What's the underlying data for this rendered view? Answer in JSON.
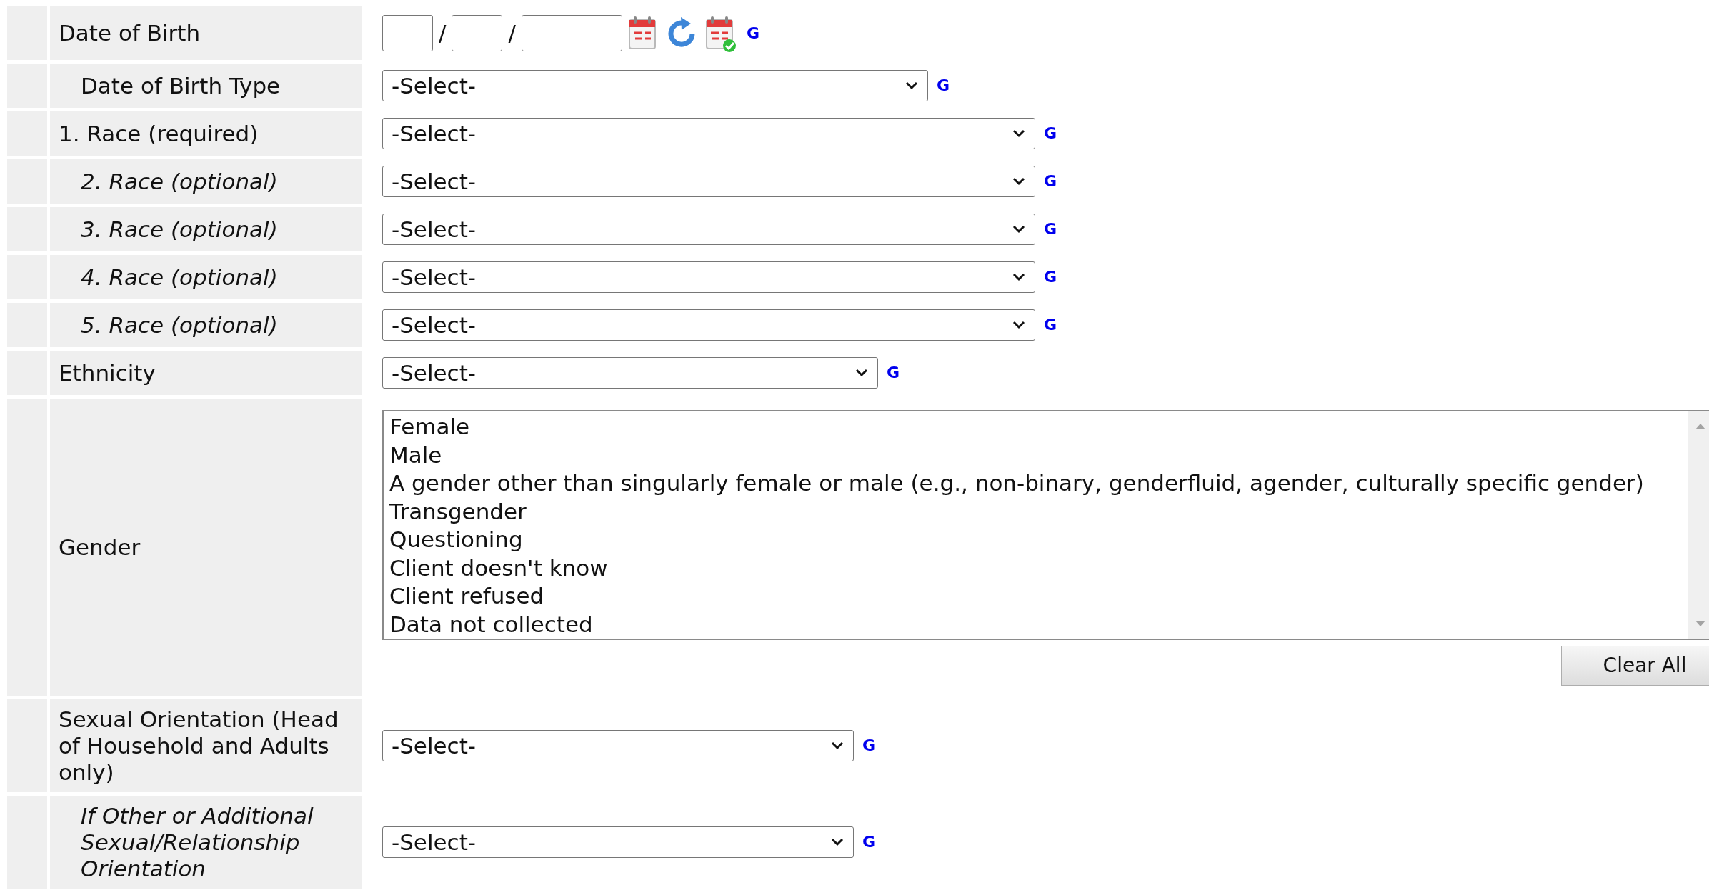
{
  "rows": [
    {
      "label": "Date of Birth",
      "indented": false,
      "italic": false,
      "field": {
        "kind": "date",
        "separators": [
          "/",
          "/"
        ],
        "help": "G"
      }
    },
    {
      "label": "Date of Birth Type",
      "indented": true,
      "italic": false,
      "field": {
        "kind": "select",
        "value": "-Select-",
        "help": "G"
      }
    },
    {
      "label": "1. Race (required)",
      "indented": false,
      "italic": false,
      "field": {
        "kind": "select",
        "value": "-Select-",
        "help": "G"
      }
    },
    {
      "label": "2. Race (optional)",
      "indented": true,
      "italic": true,
      "field": {
        "kind": "select",
        "value": "-Select-",
        "help": "G"
      }
    },
    {
      "label": "3. Race (optional)",
      "indented": true,
      "italic": true,
      "field": {
        "kind": "select",
        "value": "-Select-",
        "help": "G"
      }
    },
    {
      "label": "4. Race (optional)",
      "indented": true,
      "italic": true,
      "field": {
        "kind": "select",
        "value": "-Select-",
        "help": "G"
      }
    },
    {
      "label": "5. Race (optional)",
      "indented": true,
      "italic": true,
      "field": {
        "kind": "select",
        "value": "-Select-",
        "help": "G"
      }
    },
    {
      "label": "Ethnicity",
      "indented": false,
      "italic": false,
      "field": {
        "kind": "select",
        "value": "-Select-",
        "help": "G"
      }
    },
    {
      "label": "Gender",
      "indented": false,
      "italic": false,
      "field": {
        "kind": "listbox",
        "options": [
          {
            "text": "Female",
            "selected": false
          },
          {
            "text": "Male",
            "selected": false
          },
          {
            "text": "A gender other than singularly female or male (e.g., non-binary, genderfluid, agender, culturally specific gender)",
            "selected": false
          },
          {
            "text": "Transgender",
            "selected": false
          },
          {
            "text": "Questioning",
            "selected": false
          },
          {
            "text": "Client doesn't know",
            "selected": false
          },
          {
            "text": "Client refused",
            "selected": false
          },
          {
            "text": "Data not collected",
            "selected": false
          }
        ],
        "button": "Clear All"
      }
    },
    {
      "label": "Sexual Orientation (Head of Household and Adults only)",
      "indented": false,
      "italic": false,
      "field": {
        "kind": "select",
        "value": "-Select-",
        "help": "G"
      }
    },
    {
      "label": "If Other or Additional Sexual/Relationship Orientation",
      "indented": true,
      "italic": true,
      "field": {
        "kind": "select",
        "value": "-Select-",
        "help": "G"
      }
    }
  ]
}
